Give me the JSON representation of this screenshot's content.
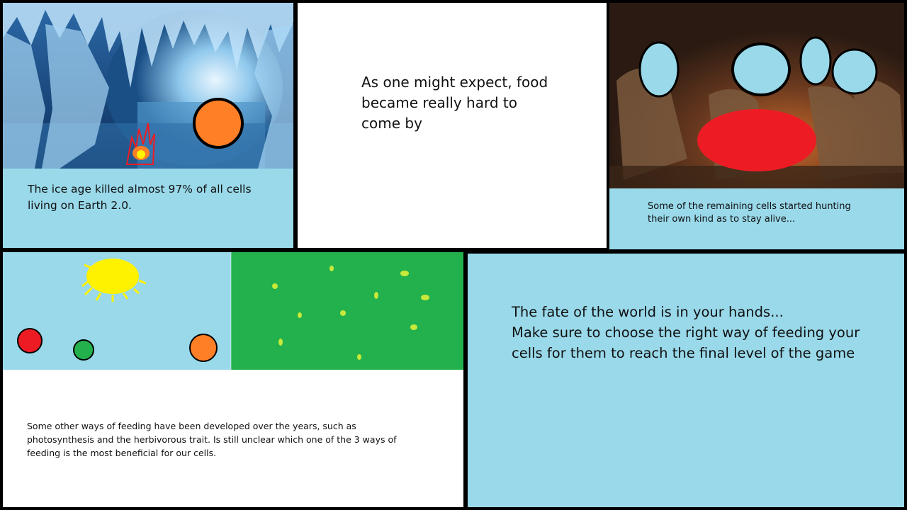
{
  "panels": {
    "ice_age": {
      "caption": "The ice age killed almost 97% of all cells\nliving on Earth 2.0."
    },
    "food": {
      "caption": "As one might expect, food\nbecame really hard to\ncome by"
    },
    "hunting": {
      "caption": "Some of the remaining cells started hunting\ntheir own kind as to stay alive..."
    },
    "feeding_ways": {
      "caption": "Some other ways of feeding have been developed over the years, such as\nphotosynthesis and the herbivorous trait. Is still unclear which one of the 3 ways of\nfeeding is the most beneficial for our cells."
    },
    "fate": {
      "caption": "The fate of the world is in your hands...\nMake sure to choose the right way of feeding your\ncells for them to reach the final level of the game"
    }
  },
  "colors": {
    "panel_blue": "#99d9ea",
    "grass_green": "#22b14c",
    "cell_red": "#ed1c24",
    "cell_green": "#22b14c",
    "cell_orange": "#ff7f27",
    "sun_yellow": "#fff200",
    "seed_yellow": "#c8e83a"
  }
}
